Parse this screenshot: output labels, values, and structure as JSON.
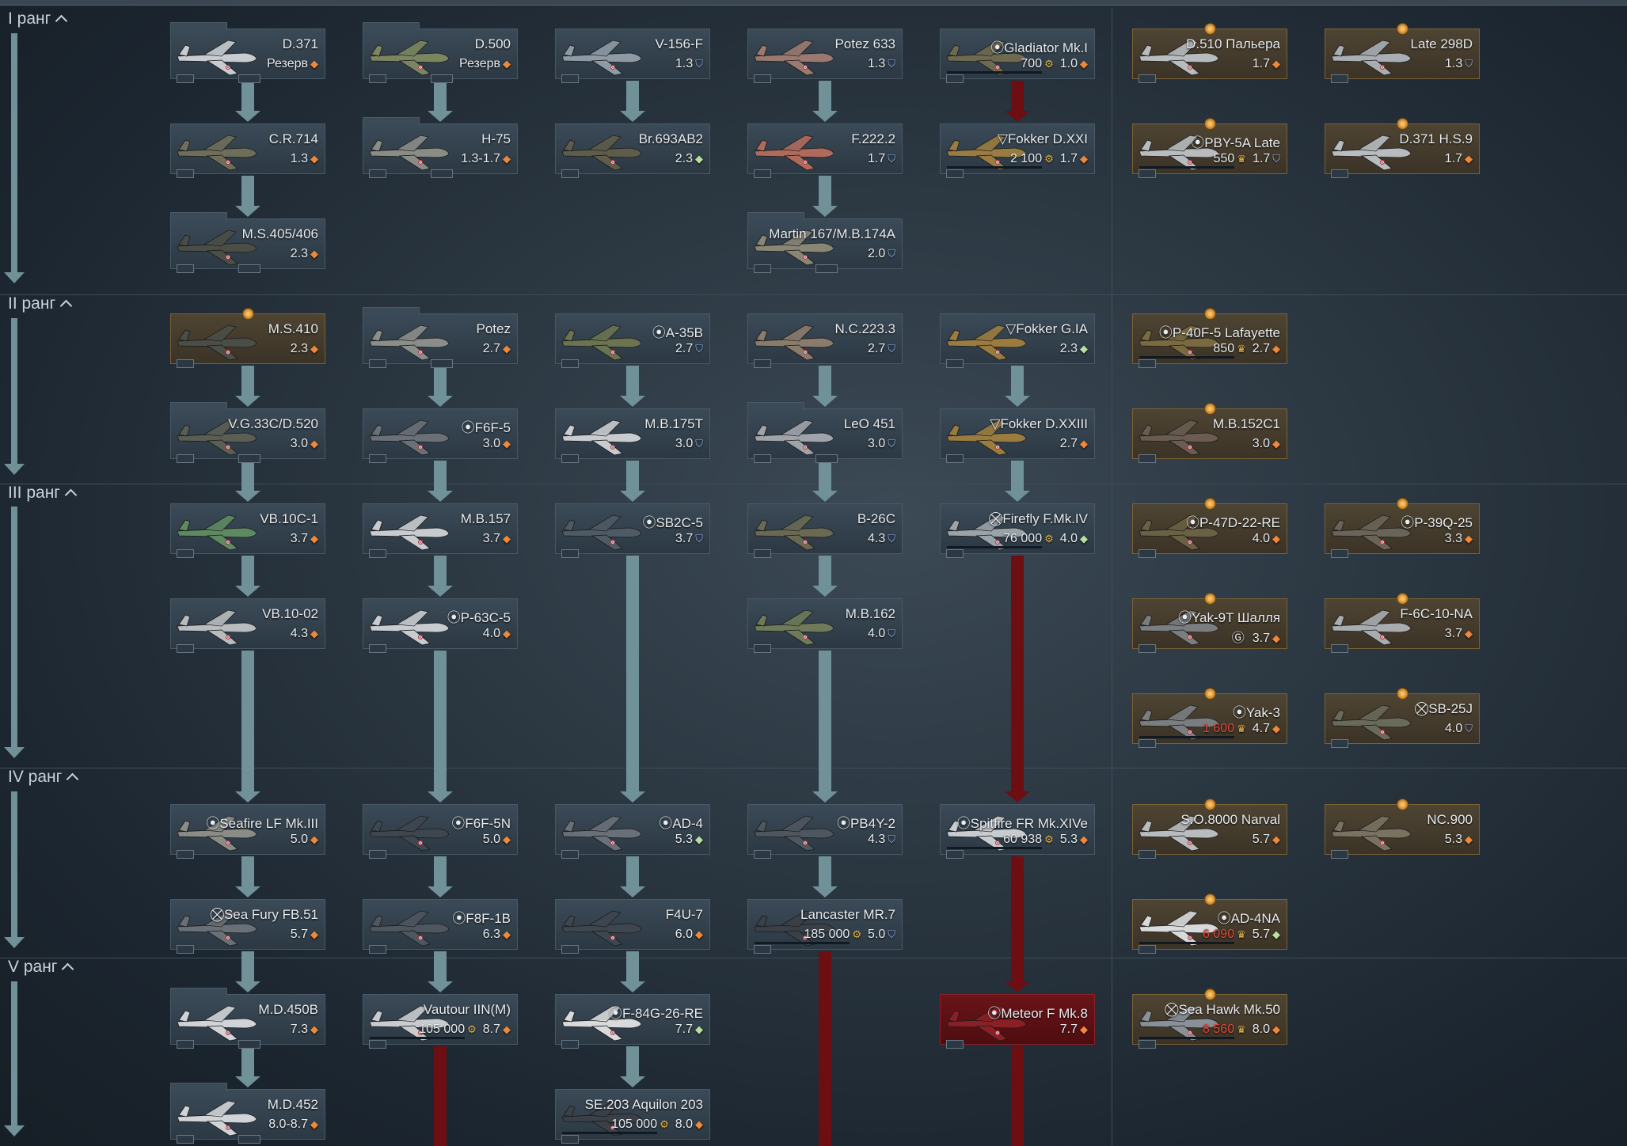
{
  "ranks": [
    {
      "label": "I ранг"
    },
    {
      "label": "II ранг"
    },
    {
      "label": "III ранг"
    },
    {
      "label": "IV ранг"
    },
    {
      "label": "V ранг"
    }
  ],
  "vehicles": [
    {
      "name": "D.371",
      "br": "Резерв",
      "br_icon": "orange",
      "style": "folder",
      "plane": "#c8ccd0"
    },
    {
      "name": "D.500",
      "br": "Резерв",
      "br_icon": "orange",
      "style": "folder",
      "plane": "#7b8660"
    },
    {
      "name": "V-156-F",
      "br": "1.3",
      "br_icon": "blue",
      "plane": "#8e9aa6"
    },
    {
      "name": "Potez 633",
      "br": "1.3",
      "br_icon": "blue",
      "plane": "#9a7a70"
    },
    {
      "name": "Gladiator Mk.I",
      "price": "700",
      "br": "1.0",
      "br_icon": "orange",
      "mark": "⦿",
      "plane": "#6e6a50"
    },
    {
      "name": "D.510 Пальера",
      "br": "1.7",
      "br_icon": "orange",
      "style": "premium",
      "plane": "#b8bcbe"
    },
    {
      "name": "Late 298D",
      "br": "1.3",
      "br_icon": "blue",
      "style": "premium",
      "plane": "#a8aeb4"
    },
    {
      "name": "C.R.714",
      "br": "1.3",
      "br_icon": "orange",
      "plane": "#6f6e5a"
    },
    {
      "name": "H-75",
      "br": "1.3-1.7",
      "br_icon": "orange",
      "style": "folder",
      "plane": "#8a8c86"
    },
    {
      "name": "Br.693AB2",
      "br": "2.3",
      "br_icon": "green",
      "plane": "#5e5c4a"
    },
    {
      "name": "F.222.2",
      "br": "1.7",
      "br_icon": "blue",
      "plane": "#b06a5c"
    },
    {
      "name": "Fokker D.XXI",
      "price": "2 100",
      "br": "1.7",
      "br_icon": "orange",
      "mark": "▽",
      "plane": "#9a7c40"
    },
    {
      "name": "PBY-5A Late",
      "price": "550",
      "br": "1.7",
      "br_icon": "blue",
      "mark": "⦿",
      "style": "premium",
      "plane": "#b8bcbe"
    },
    {
      "name": "D.371 H.S.9",
      "br": "1.7",
      "br_icon": "orange",
      "style": "premium",
      "plane": "#b8bcbe"
    },
    {
      "name": "M.S.405/406",
      "br": "2.3",
      "br_icon": "orange",
      "style": "folder",
      "plane": "#4a4e46"
    },
    {
      "name": "Martin 167/M.B.174A",
      "br": "2.0",
      "br_icon": "blue",
      "style": "folder",
      "plane": "#8a8676"
    },
    {
      "name": "M.S.410",
      "br": "2.3",
      "br_icon": "orange",
      "style": "premium-mono",
      "plane": "#4a4e46"
    },
    {
      "name": "Potez",
      "br": "2.7",
      "br_icon": "orange",
      "style": "folder",
      "plane": "#8a8e8a"
    },
    {
      "name": "A-35B",
      "br": "2.7",
      "br_icon": "blue",
      "mark": "⦿",
      "plane": "#6a7450"
    },
    {
      "name": "N.C.223.3",
      "br": "2.7",
      "br_icon": "blue",
      "plane": "#8a7c6c"
    },
    {
      "name": "Fokker G.IA",
      "br": "2.3",
      "br_icon": "green",
      "mark": "▽",
      "plane": "#9a7c40"
    },
    {
      "name": "P-40F-5 Lafayette",
      "price": "850",
      "br": "2.7",
      "br_icon": "orange",
      "mark": "⦿",
      "style": "premium",
      "plane": "#7a6a40"
    },
    {
      "name": "V.G.33C/D.520",
      "br": "3.0",
      "br_icon": "orange",
      "style": "folder",
      "plane": "#5a5e54"
    },
    {
      "name": "F6F-5",
      "br": "3.0",
      "br_icon": "orange",
      "mark": "⦿",
      "plane": "#6a7078"
    },
    {
      "name": "M.B.175T",
      "br": "3.0",
      "br_icon": "blue",
      "plane": "#c8ccd0"
    },
    {
      "name": "LeO 451",
      "br": "3.0",
      "br_icon": "blue",
      "style": "folder",
      "plane": "#9ea4aa"
    },
    {
      "name": "Fokker D.XXIII",
      "br": "2.7",
      "br_icon": "orange",
      "mark": "▽",
      "plane": "#9a7c40"
    },
    {
      "name": "M.B.152C1",
      "br": "3.0",
      "br_icon": "orange",
      "style": "premium",
      "plane": "#6a5c50"
    },
    {
      "name": "VB.10C-1",
      "br": "3.7",
      "br_icon": "orange",
      "plane": "#5e8a62"
    },
    {
      "name": "M.B.157",
      "br": "3.7",
      "br_icon": "orange",
      "plane": "#c8ccd0"
    },
    {
      "name": "SB2C-5",
      "br": "3.7",
      "br_icon": "blue",
      "mark": "⦿",
      "plane": "#4e5a66"
    },
    {
      "name": "B-26C",
      "br": "4.3",
      "br_icon": "blue",
      "plane": "#6a6a54"
    },
    {
      "name": "Firefly F.Mk.IV",
      "price": "76 000",
      "br": "4.0",
      "br_icon": "green",
      "mark": "⛒",
      "plane": "#9aa2aa"
    },
    {
      "name": "P-47D-22-RE",
      "br": "4.0",
      "br_icon": "orange",
      "mark": "⦿",
      "style": "premium",
      "plane": "#6a6044"
    },
    {
      "name": "P-39Q-25",
      "br": "3.3",
      "br_icon": "orange",
      "mark": "⦿",
      "style": "premium",
      "plane": "#6a6458"
    },
    {
      "name": "VB.10-02",
      "br": "4.3",
      "br_icon": "orange",
      "plane": "#b8bcbe"
    },
    {
      "name": "P-63C-5",
      "br": "4.0",
      "br_icon": "orange",
      "mark": "⦿",
      "plane": "#c8ccd0"
    },
    {
      "name": "M.B.162",
      "br": "4.0",
      "br_icon": "blue",
      "plane": "#6e7a58"
    },
    {
      "name": "Yak-9T Шалля",
      "br": "3.7",
      "br_icon": "orange",
      "mark": "⦿",
      "extra": "Ⓖ",
      "style": "premium-dark",
      "plane": "#7a7e80"
    },
    {
      "name": "F-6C-10-NA",
      "br": "3.7",
      "br_icon": "orange",
      "style": "premium",
      "plane": "#a8acae"
    },
    {
      "name": "Yak-3",
      "price": "1 600",
      "price_color": "red",
      "br": "4.7",
      "br_icon": "orange",
      "mark": "⦿",
      "style": "premium-dark",
      "plane": "#7a7e80"
    },
    {
      "name": "SB-25J",
      "br": "4.0",
      "br_icon": "blue",
      "mark": "⛒",
      "style": "premium",
      "plane": "#6a6a5a"
    },
    {
      "name": "Seafire LF Mk.III",
      "br": "5.0",
      "br_icon": "orange",
      "mark": "⦿",
      "plane": "#8a8c86"
    },
    {
      "name": "F6F-5N",
      "br": "5.0",
      "br_icon": "orange",
      "mark": "⦿",
      "plane": "#3e4650"
    },
    {
      "name": "AD-4",
      "br": "5.3",
      "br_icon": "green",
      "mark": "⦿",
      "plane": "#6a7078"
    },
    {
      "name": "PB4Y-2",
      "br": "4.3",
      "br_icon": "blue",
      "mark": "⦿",
      "plane": "#4e5660"
    },
    {
      "name": "Spitfire FR Mk.XIVe",
      "price": "60 938",
      "br": "5.3",
      "br_icon": "orange",
      "mark": "⦿",
      "plane": "#c8ccd0"
    },
    {
      "name": "S.O.8000 Narval",
      "br": "5.7",
      "br_icon": "orange",
      "style": "premium",
      "plane": "#b8bcbe"
    },
    {
      "name": "NC.900",
      "br": "5.3",
      "br_icon": "orange",
      "style": "premium",
      "plane": "#7a7260"
    },
    {
      "name": "Sea Fury FB.51",
      "br": "5.7",
      "br_icon": "orange",
      "mark": "⛒",
      "plane": "#6a7078"
    },
    {
      "name": "F8F-1B",
      "br": "6.3",
      "br_icon": "orange",
      "mark": "⦿",
      "plane": "#4e5660"
    },
    {
      "name": "F4U-7",
      "br": "6.0",
      "br_icon": "orange",
      "plane": "#3e4650"
    },
    {
      "name": "Lancaster MR.7",
      "price": "185 000",
      "br": "5.0",
      "br_icon": "blue",
      "plane": "#3a4048"
    },
    {
      "name": "AD-4NA",
      "price": "6 090",
      "price_color": "red",
      "br": "5.7",
      "br_icon": "green",
      "mark": "⦿",
      "style": "premium",
      "plane": "#d8dadc"
    },
    {
      "name": "M.D.450B",
      "br": "7.3",
      "br_icon": "orange",
      "style": "folder",
      "plane": "#d0d4d8"
    },
    {
      "name": "Vautour IIN(M)",
      "price": "105 000",
      "br": "8.7",
      "br_icon": "orange",
      "plane": "#c8ccd0"
    },
    {
      "name": "F-84G-26-RE",
      "br": "7.7",
      "br_icon": "green",
      "mark": "⦿",
      "plane": "#d8dadc"
    },
    {
      "name": "Meteor F Mk.8",
      "br": "7.7",
      "br_icon": "orange",
      "mark": "⦿",
      "style": "red",
      "plane": "#8a2025"
    },
    {
      "name": "Sea Hawk Mk.50",
      "price": "8 560",
      "price_color": "red",
      "br": "8.0",
      "br_icon": "orange",
      "mark": "⛒",
      "style": "premium-dark",
      "plane": "#8a9098"
    },
    {
      "name": "M.D.452",
      "br": "8.0-8.7",
      "br_icon": "orange",
      "style": "folder",
      "plane": "#d0d4d8"
    },
    {
      "name": "SE.203 Aquilon 203",
      "price": "105 000",
      "br": "8.0",
      "br_icon": "orange",
      "plane": "#3a4048"
    }
  ]
}
